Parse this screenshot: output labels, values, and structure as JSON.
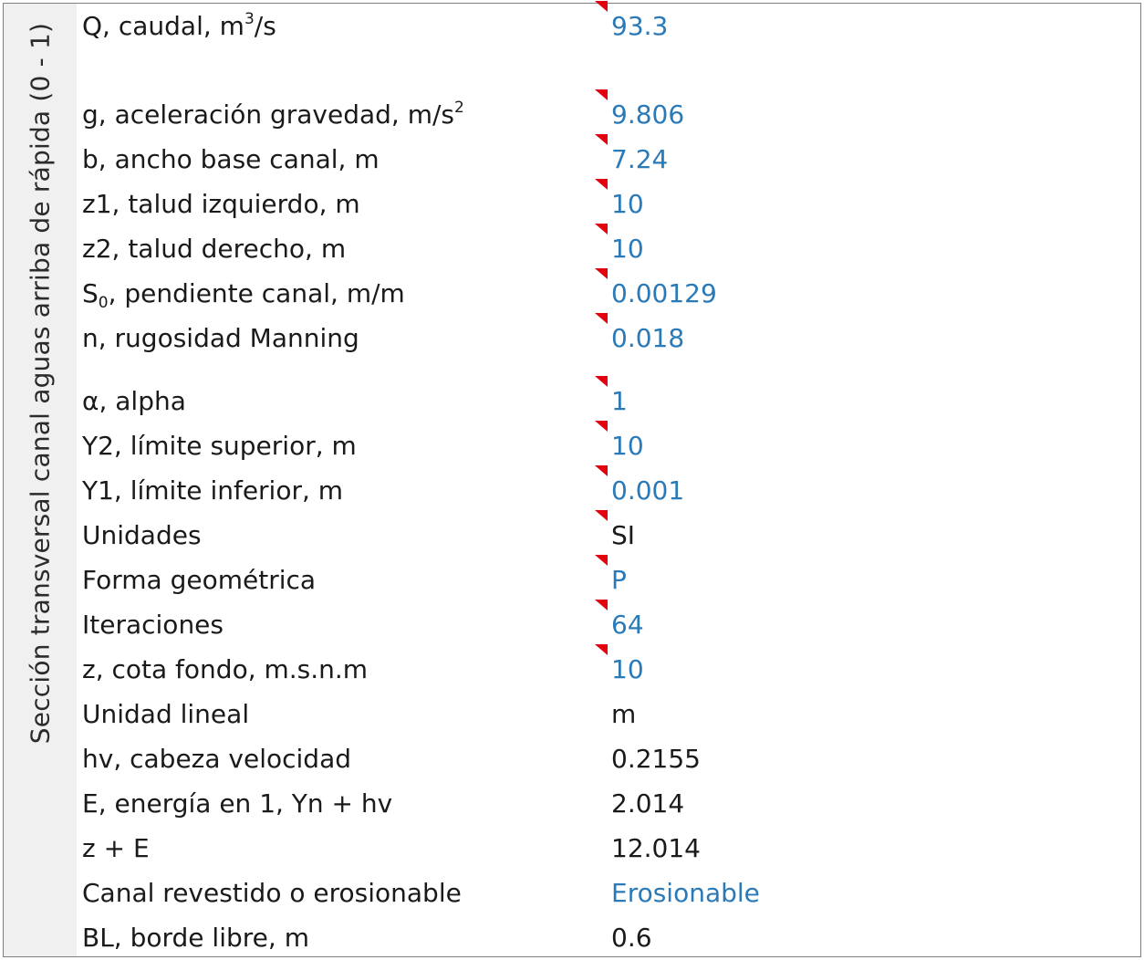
{
  "section_title": "Sección transversal canal aguas arriba de rápida (0 - 1)",
  "rows": [
    {
      "label_pre": "Q, caudal, m",
      "sup": "3",
      "label_post": "/s",
      "value": "93.3",
      "value_type": "input",
      "flag": true
    },
    {
      "label_pre": "g, aceleración gravedad, m/s",
      "sup": "2",
      "label_post": "",
      "value": "9.806",
      "value_type": "input",
      "flag": true
    },
    {
      "label_pre": "b, ancho base canal, m",
      "sup": "",
      "label_post": "",
      "value": "7.24",
      "value_type": "input",
      "flag": true
    },
    {
      "label_pre": "z1, talud izquierdo, m",
      "sup": "",
      "label_post": "",
      "value": "10",
      "value_type": "input",
      "flag": true
    },
    {
      "label_pre": "z2, talud derecho, m",
      "sup": "",
      "label_post": "",
      "value": "10",
      "value_type": "input",
      "flag": true
    },
    {
      "label_pre": "S",
      "sub": "0",
      "label_post": ", pendiente canal, m/m",
      "value": "0.00129",
      "value_type": "input",
      "flag": true
    },
    {
      "label_pre": "n, rugosidad Manning",
      "sup": "",
      "label_post": "",
      "value": "0.018",
      "value_type": "input",
      "flag": true
    },
    {
      "label_pre": "α, alpha",
      "sup": "",
      "label_post": "",
      "value": "1",
      "value_type": "input",
      "flag": true
    },
    {
      "label_pre": "Y2, límite superior, m",
      "sup": "",
      "label_post": "",
      "value": "10",
      "value_type": "input",
      "flag": true
    },
    {
      "label_pre": "Y1, límite inferior, m",
      "sup": "",
      "label_post": "",
      "value": "0.001",
      "value_type": "input",
      "flag": true
    },
    {
      "label_pre": "Unidades",
      "sup": "",
      "label_post": "",
      "value": "SI",
      "value_type": "calc",
      "flag": true
    },
    {
      "label_pre": "Forma geométrica",
      "sup": "",
      "label_post": "",
      "value": "P",
      "value_type": "input",
      "flag": true
    },
    {
      "label_pre": "Iteraciones",
      "sup": "",
      "label_post": "",
      "value": "64",
      "value_type": "input",
      "flag": true
    },
    {
      "label_pre": "z, cota fondo, m.s.n.m",
      "sup": "",
      "label_post": "",
      "value": "10",
      "value_type": "input",
      "flag": true
    },
    {
      "label_pre": "Unidad lineal",
      "sup": "",
      "label_post": "",
      "value": "m",
      "value_type": "calc",
      "flag": false
    },
    {
      "label_pre": "hv, cabeza velocidad",
      "sup": "",
      "label_post": "",
      "value": "0.2155",
      "value_type": "calc",
      "flag": false
    },
    {
      "label_pre": "E, energía en 1, Yn + hv",
      "sup": "",
      "label_post": "",
      "value": "2.014",
      "value_type": "calc",
      "flag": false
    },
    {
      "label_pre": "z + E",
      "sup": "",
      "label_post": "",
      "value": "12.014",
      "value_type": "calc",
      "flag": false
    },
    {
      "label_pre": "Canal revestido o erosionable",
      "sup": "",
      "label_post": "",
      "value": "Erosionable",
      "value_type": "input",
      "flag": false
    },
    {
      "label_pre": "BL, borde libre, m",
      "sup": "",
      "label_post": "",
      "value": "0.6",
      "value_type": "calc",
      "flag": false
    }
  ],
  "colors": {
    "input_value": "#2a7ab8",
    "calc_value": "#1a1a1a",
    "comment_flag": "#e3000f",
    "side_band": "#f0f0f0"
  }
}
